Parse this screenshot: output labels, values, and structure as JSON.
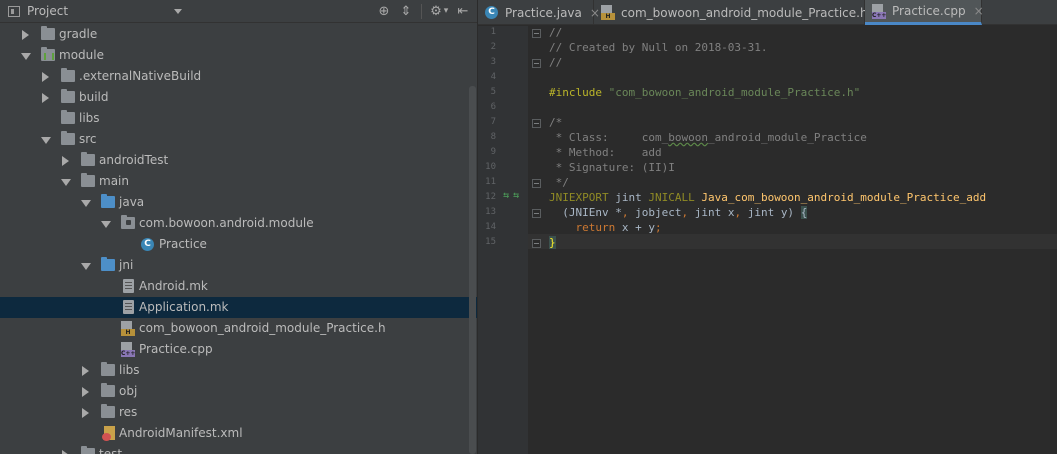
{
  "project_panel": {
    "title": "Project",
    "tools": {
      "locate": "⊕",
      "collapse": "⇕",
      "settings": "⚙",
      "settings_arrow": "▾",
      "hide": "⇤"
    },
    "tree": [
      {
        "label": "gradle",
        "expanded": false
      },
      {
        "label": "module",
        "expanded": true
      },
      {
        "label": ".externalNativeBuild",
        "expanded": false
      },
      {
        "label": "build",
        "expanded": false
      },
      {
        "label": "libs"
      },
      {
        "label": "src",
        "expanded": true
      },
      {
        "label": "androidTest",
        "expanded": false
      },
      {
        "label": "main",
        "expanded": true
      },
      {
        "label": "java",
        "expanded": true
      },
      {
        "label": "com.bowoon.android.module",
        "expanded": true
      },
      {
        "label": "Practice",
        "icon": "C"
      },
      {
        "label": "jni",
        "expanded": true
      },
      {
        "label": "Android.mk"
      },
      {
        "label": "Application.mk",
        "selected": true
      },
      {
        "label": "com_bowoon_android_module_Practice.h",
        "icon_tag": "H"
      },
      {
        "label": "Practice.cpp",
        "icon_tag": "C++"
      },
      {
        "label": "libs",
        "expanded": false
      },
      {
        "label": "obj",
        "expanded": false
      },
      {
        "label": "res",
        "expanded": false
      },
      {
        "label": "AndroidManifest.xml"
      },
      {
        "label": "test",
        "expanded": false
      }
    ]
  },
  "editor": {
    "tabs": [
      {
        "label": "Practice.java",
        "icon": "C",
        "close": "×"
      },
      {
        "label": "com_bowoon_android_module_Practice.h",
        "icon_tag": "H",
        "close": "×"
      },
      {
        "label": "Practice.cpp",
        "icon_tag": "C++",
        "close": "×",
        "active": true
      }
    ],
    "line_numbers": [
      "1",
      "2",
      "3",
      "4",
      "5",
      "6",
      "7",
      "8",
      "9",
      "10",
      "11",
      "12",
      "13",
      "14",
      "15"
    ],
    "gutter_marker": "⇆⇆",
    "code": {
      "l1": "//",
      "l2": "// Created by Null on 2018-03-31.",
      "l3": "//",
      "l5_kw": "#include",
      "l5_str": "\"com_bowoon_android_module_Practice.h\"",
      "l7": "/*",
      "l8_a": " * Class:     com_",
      "l8_b": "bowoon",
      "l8_c": "_android_module_Practice",
      "l9": " * Method:    add",
      "l10": " * Signature: (II)I",
      "l11": " */",
      "l12_a": "JNIEXPORT",
      "l12_b": " jint ",
      "l12_c": "JNICALL",
      "l12_d": " Java_com_bowoon_android_module_Practice_add",
      "l13_a": "  (JNIEnv *",
      "l13_b": ",",
      "l13_c": " jobject",
      "l13_d": ",",
      "l13_e": " jint x",
      "l13_f": ",",
      "l13_g": " jint y) ",
      "l13_h": "{",
      "l14_a": "    ",
      "l14_b": "return",
      "l14_c": " x + y",
      "l14_d": ";",
      "l15": "}"
    }
  },
  "colors": {
    "panel_bg": "#3c3f41",
    "editor_bg": "#2b2b2b",
    "selection": "#0d293e",
    "active_tab_underline": "#4a88c7"
  }
}
